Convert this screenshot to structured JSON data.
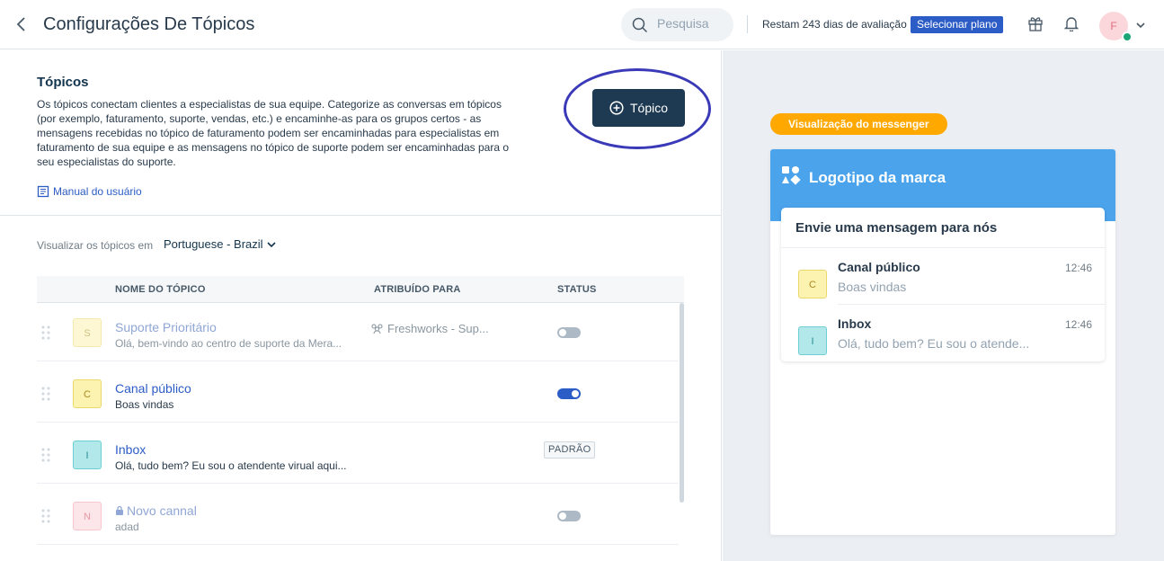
{
  "header": {
    "title": "Configurações De Tópicos",
    "search_placeholder": "Pesquisa",
    "trial_text": "Restam 243 dias de avaliação",
    "plan_button": "Selecionar plano",
    "avatar_initial": "F"
  },
  "intro": {
    "title": "Tópicos",
    "description": "Os tópicos conectam clientes a especialistas de sua equipe. Categorize as conversas em tópicos (por exemplo, faturamento, suporte, vendas, etc.) e encaminhe-as para os grupos certos - as mensagens recebidas no tópico de faturamento podem ser encaminhadas para especialistas em faturamento de sua equipe e as mensagens no tópico de suporte podem ser encaminhadas para o seu especialistas do suporte.",
    "manual_link": "Manual do usuário",
    "add_button": "Tópico"
  },
  "filter": {
    "label": "Visualizar os tópicos em",
    "language": "Portuguese - Brazil"
  },
  "table": {
    "headers": [
      "NOME DO TÓPICO",
      "ATRIBUÍDO PARA",
      "STATUS"
    ],
    "rows": [
      {
        "initial": "S",
        "name": "Suporte Prioritário",
        "message": "Olá, bem-vindo ao centro de suporte da Mera...",
        "assigned": "Freshworks - Sup...",
        "status": "off"
      },
      {
        "initial": "C",
        "name": "Canal público",
        "message": "Boas vindas",
        "assigned": "",
        "status": "on"
      },
      {
        "initial": "I",
        "name": "Inbox",
        "message": "Olá, tudo bem? Eu sou o atendente virual aqui...",
        "assigned": "",
        "status": "PADRÃO"
      },
      {
        "initial": "N",
        "name": "Novo cannal",
        "message": "adad",
        "assigned": "",
        "status": "off"
      }
    ]
  },
  "preview": {
    "tag": "Visualização do messenger",
    "brand_title": "Logotipo da marca",
    "card_title": "Envie uma mensagem para nós",
    "items": [
      {
        "initial": "C",
        "name": "Canal público",
        "message": "Boas vindas",
        "time": "12:46"
      },
      {
        "initial": "I",
        "name": "Inbox",
        "message": "Olá, tudo bem? Eu sou o atende...",
        "time": "12:46"
      }
    ]
  },
  "colors": {
    "accent": "#2c5cc5",
    "dark_button": "#1d3a52",
    "brand_header": "#4ba3ec",
    "preview_tag": "#ffa800",
    "highlight": "#3a3ab8"
  }
}
